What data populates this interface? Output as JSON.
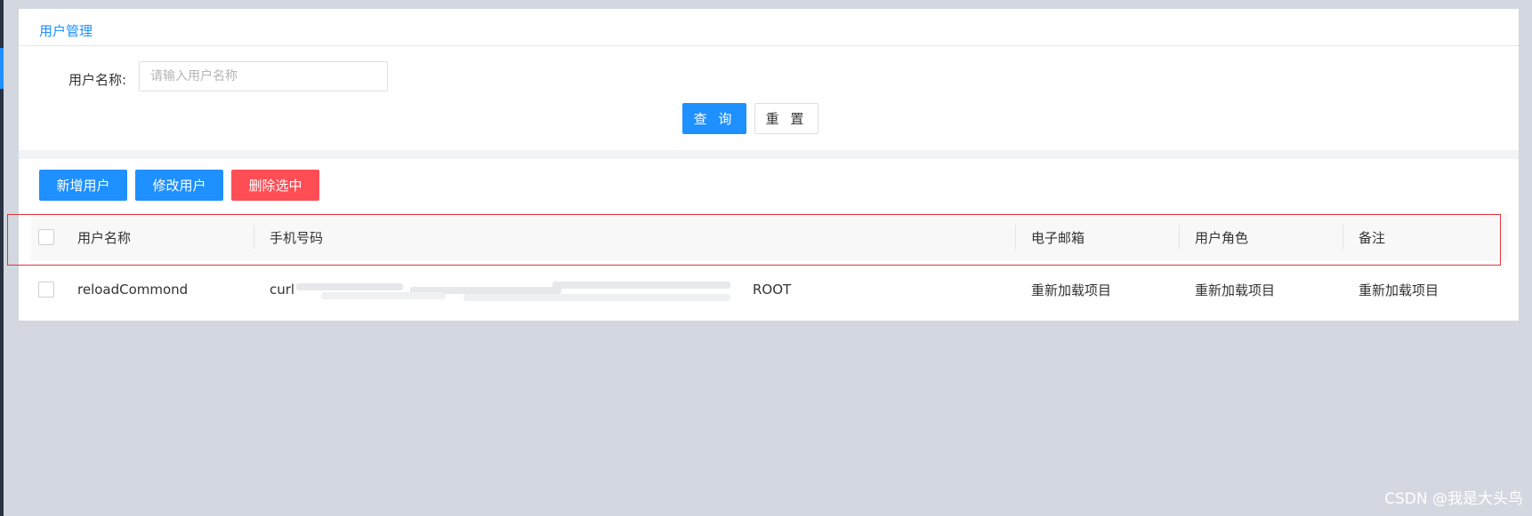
{
  "page": {
    "title": "用户管理",
    "watermark": "CSDN @我是大头鸟"
  },
  "search": {
    "label": "用户名称:",
    "value": "",
    "placeholder": "请输入用户名称",
    "query_label": "查 询",
    "reset_label": "重 置"
  },
  "toolbar": {
    "add_label": "新增用户",
    "edit_label": "修改用户",
    "delete_label": "删除选中"
  },
  "table": {
    "columns": [
      "用户名称",
      "手机号码",
      "电子邮箱",
      "用户角色",
      "备注"
    ],
    "rows": [
      {
        "username": "reloadCommond",
        "phone_prefix": "curl",
        "phone_suffix": "ROOT",
        "email": "重新加载项目",
        "role": "重新加载项目",
        "remark": "重新加载项目"
      }
    ]
  },
  "colors": {
    "primary": "#1e90ff",
    "danger": "#ff4d55",
    "highlight_border": "#e0353a"
  }
}
